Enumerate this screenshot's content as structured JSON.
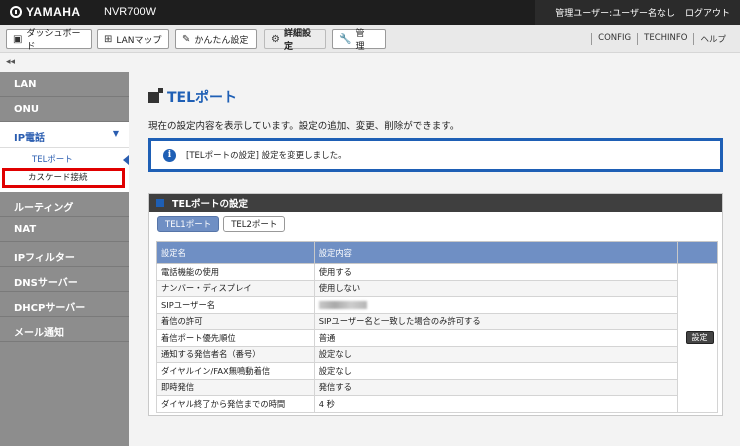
{
  "header": {
    "brand": "YAMAHA",
    "model": "NVR700W",
    "user": "管理ユーザー:ユーザー名なし",
    "logout": "ログアウト"
  },
  "nav": {
    "buttons": [
      {
        "label": "ダッシュボード",
        "icon": "dashboard-icon"
      },
      {
        "label": "LANマップ",
        "icon": "lan-map-icon"
      },
      {
        "label": "かんたん設定",
        "icon": "wizard-icon"
      },
      {
        "label": "詳細設定",
        "icon": "gear-icon"
      },
      {
        "label": "管　理",
        "icon": "wrench-icon"
      }
    ],
    "links": [
      "CONFIG",
      "TECHINFO",
      "ヘルプ"
    ],
    "collapse": "◂◂"
  },
  "sidebar": {
    "items_top": [
      "LAN",
      "ONU"
    ],
    "open": {
      "label": "IP電話",
      "sub": [
        "TELポート",
        "カスケード接続"
      ]
    },
    "items_bottom": [
      "ルーティング",
      "NAT",
      "IPフィルター",
      "DNSサーバー",
      "DHCPサーバー",
      "メール通知"
    ]
  },
  "main": {
    "title": "TELポート",
    "description": "現在の設定内容を表示しています。設定の追加、変更、削除ができます。",
    "info": "[TELポートの設定] 設定を変更しました。",
    "panel_title": "TELポートの設定",
    "tabs": [
      "TEL1ポート",
      "TEL2ポート"
    ],
    "table": {
      "headers": [
        "設定名",
        "設定内容",
        ""
      ],
      "rows": [
        [
          "電話機能の使用",
          "使用する"
        ],
        [
          "ナンバー・ディスプレイ",
          "使用しない"
        ],
        [
          "SIPユーザー名",
          ""
        ],
        [
          "着信の許可",
          "SIPユーザー名と一致した場合のみ許可する"
        ],
        [
          "着信ポート優先順位",
          "普通"
        ],
        [
          "通知する発信者名（番号）",
          "設定なし"
        ],
        [
          "ダイヤルイン/FAX無鳴動着信",
          "設定なし"
        ],
        [
          "即時発信",
          "発信する"
        ],
        [
          "ダイヤル終了から発信までの時間",
          "4 秒"
        ]
      ],
      "action": "設定"
    }
  },
  "colors": {
    "accent": "#1e5fb5",
    "topbar": "#1e1e1e",
    "sidebar": "#8d8d8d",
    "table_header": "#6f8fc4",
    "highlight": "#e00000"
  }
}
